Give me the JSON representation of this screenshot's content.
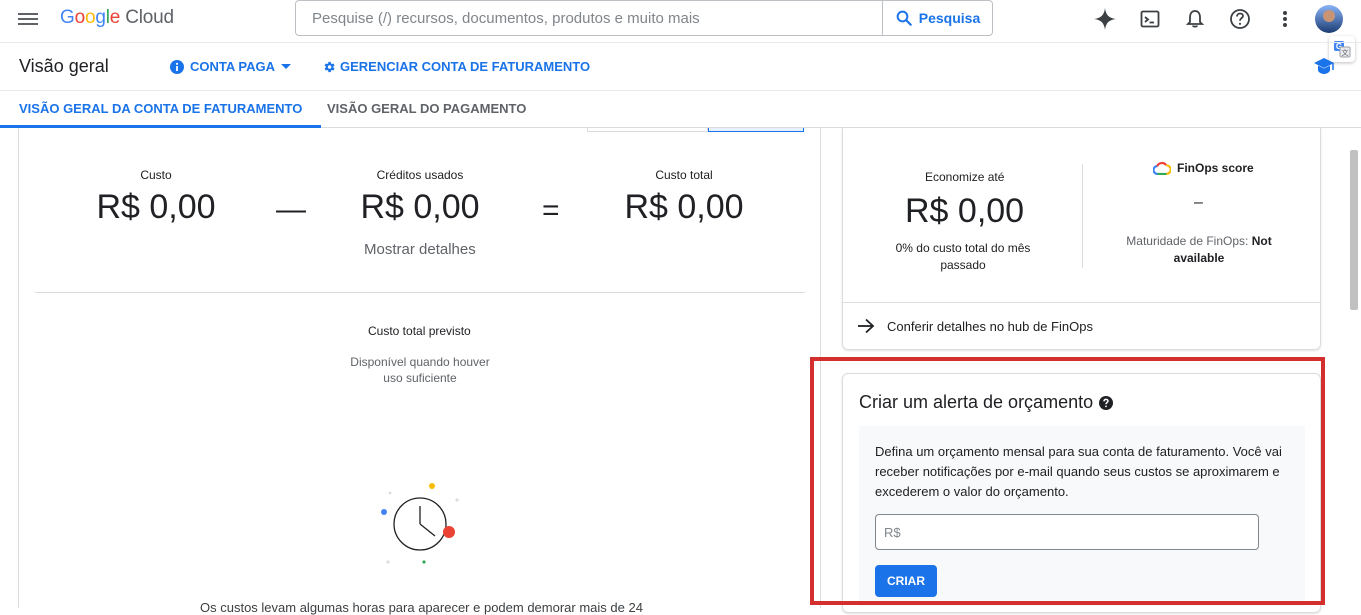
{
  "header": {
    "logo_google": "Google",
    "logo_cloud": "Cloud",
    "search_placeholder": "Pesquise (/) recursos, documentos, produtos e muito mais",
    "search_button": "Pesquisa",
    "icons": [
      "menu-icon",
      "gemini-spark-icon",
      "cloud-shell-icon",
      "notifications-icon",
      "help-icon",
      "more-vert-icon",
      "account-avatar",
      "translate-icon"
    ]
  },
  "subheader": {
    "title": "Visão geral",
    "account_type": "CONTA PAGA",
    "manage_link": "GERENCIAR CONTA DE FATURAMENTO"
  },
  "tabs": [
    {
      "label": "VISÃO GERAL DA CONTA DE FATURAMENTO",
      "active": true
    },
    {
      "label": "VISÃO GERAL DO PAGAMENTO",
      "active": false
    }
  ],
  "summary": {
    "cost_label": "Custo",
    "cost_value": "R$ 0,00",
    "minus": "—",
    "credits_label": "Créditos usados",
    "credits_value": "R$ 0,00",
    "equals": "=",
    "total_label": "Custo total",
    "total_value": "R$ 0,00",
    "details_link": "Mostrar detalhes"
  },
  "forecast": {
    "title": "Custo total previsto",
    "subtitle": "Disponível quando houver uso suficiente",
    "cut_text": "Os custos levam algumas horas para aparecer e podem demorar mais de 24"
  },
  "finops": {
    "save_label": "Economize até",
    "save_value": "R$ 0,00",
    "save_sub": "0% do custo total do mês passado",
    "score_label": "FinOps score",
    "score_value": "–",
    "maturity_label": "Maturidade de FinOps:",
    "maturity_value": "Not available",
    "hub_link": "Conferir detalhes no hub de FinOps"
  },
  "budget": {
    "title": "Criar um alerta de orçamento",
    "description": "Defina um orçamento mensal para sua conta de faturamento. Você vai receber notificações por e-mail quando seus custos se aproximarem e excederem o valor do orçamento.",
    "input_placeholder": "R$",
    "button": "CRIAR"
  },
  "colors": {
    "accent": "#1a73e8",
    "highlight": "#d32f2f",
    "text": "#202124",
    "muted": "#5f6368"
  }
}
